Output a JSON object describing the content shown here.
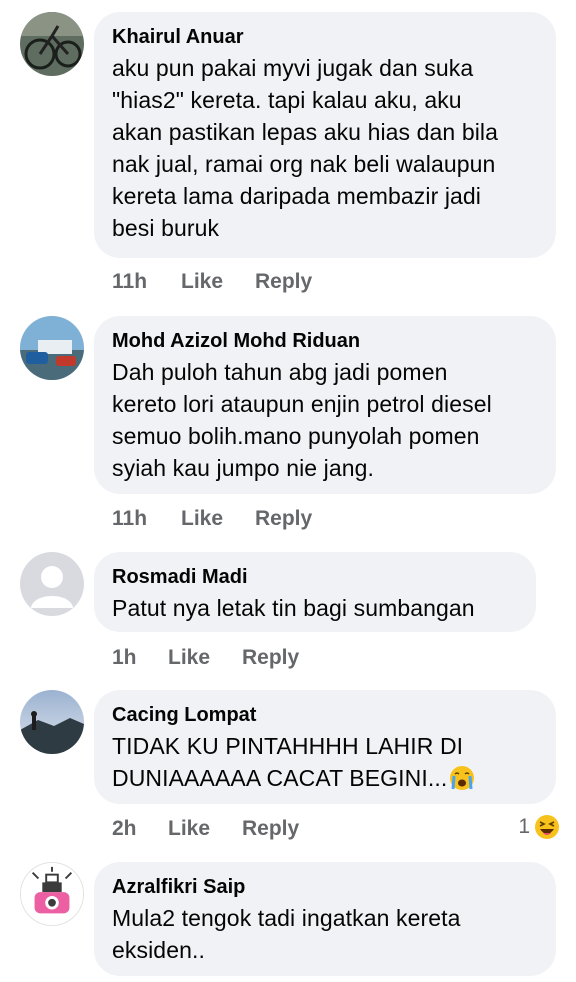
{
  "comments": [
    {
      "author": "Khairul Anuar",
      "text": "aku pun pakai myvi jugak dan suka\n\"hias2\" kereta. tapi kalau aku, aku\nakan pastikan lepas aku hias dan bila\nnak jual, ramai org nak beli walaupun\nkereta lama daripada membazir jadi\nbesi buruk",
      "time": "11h",
      "like": "Like",
      "reply": "Reply"
    },
    {
      "author": "Mohd Azizol Mohd Riduan",
      "text": "Dah puloh tahun abg jadi pomen\nkereto lori ataupun enjin petrol diesel\nsemuo bolih.mano punyolah pomen\nsyiah kau jumpo nie jang.",
      "time": "11h",
      "like": "Like",
      "reply": "Reply"
    },
    {
      "author": "Rosmadi Madi",
      "text": "Patut nya letak tin bagi sumbangan",
      "time": "1h",
      "like": "Like",
      "reply": "Reply"
    },
    {
      "author": "Cacing Lompat",
      "text": "TIDAK KU PINTAHHHH LAHIR DI\nDUNIAAAAAA CACAT BEGINI...",
      "emoji": "crying-face",
      "time": "2h",
      "like": "Like",
      "reply": "Reply",
      "reaction_count": "1",
      "reaction_icon": "haha-reaction"
    },
    {
      "author": "Azralfikri Saip",
      "text": "Mula2 tengok tadi ingatkan kereta\neksiden..",
      "time": "",
      "like": "",
      "reply": ""
    }
  ],
  "colors": {
    "bubble": "#f0f2f5",
    "meta_text": "#65676b",
    "text": "#050505"
  }
}
